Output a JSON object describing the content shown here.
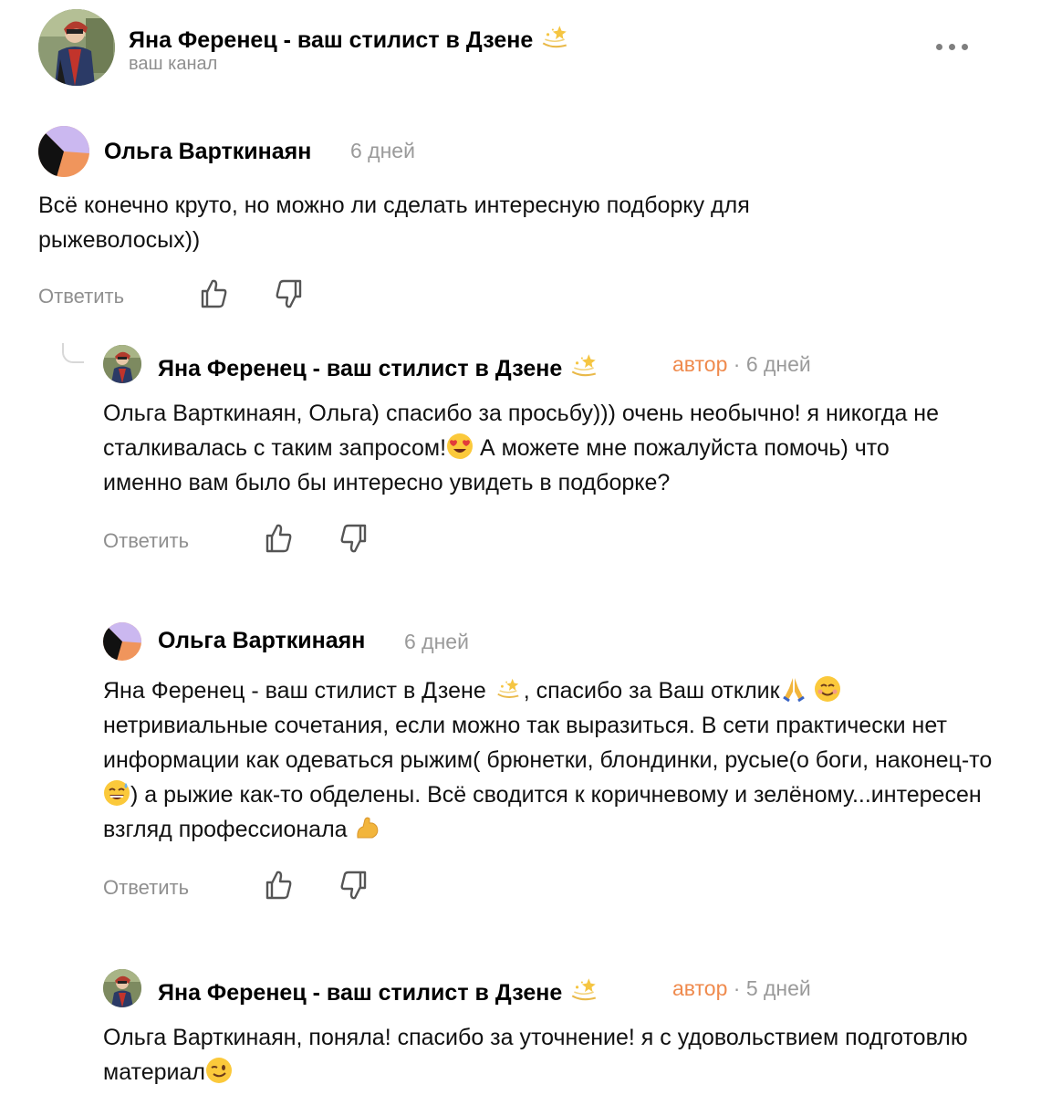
{
  "channel": {
    "title": "Яна Ференец - ваш стилист в Дзене",
    "subtitle": "ваш канал",
    "more_icon": "more-dots-icon"
  },
  "common": {
    "reply_label": "Ответить",
    "like_icon": "thumbs-up-icon",
    "dislike_icon": "thumbs-down-icon"
  },
  "comments": [
    {
      "author": "Ольга Варткинаян",
      "time": "6 дней",
      "text": "Всё конечно круто, но можно ли сделать интересную подборку для рыжеволосых))"
    },
    {
      "author": "Яна Ференец - ваш стилист в Дзене",
      "badge": "автор",
      "time": "6 дней",
      "text_parts": [
        "Ольга Варткинаян, Ольга) спасибо за просьбу))) очень необычно! я никогда не сталкивалась с таким запросом!",
        " А можете мне пожалуйста помочь) что именно вам было бы интересно увидеть в подборке?"
      ]
    },
    {
      "author": "Ольга Варткинаян",
      "time": "6 дней",
      "text_parts": [
        "Яна Ференец - ваш стилист в Дзене ",
        ", спасибо за Ваш отклик",
        " нетривиальные сочетания, если можно так выразиться. В сети практически нет информации как одеваться рыжим( брюнетки, блондинки, русые(о боги, наконец-то",
        ") а рыжие как-то обделены. Всё сводится к коричневому и зелёному...интересен взгляд профессионала"
      ]
    },
    {
      "author": "Яна Ференец - ваш стилист в Дзене",
      "badge": "автор",
      "time": "5 дней",
      "text_parts": [
        "Ольга Варткинаян, поняла! спасибо за уточнение! я с удовольствием подготовлю материал"
      ]
    }
  ],
  "colors": {
    "author_badge": "#ef8a4d",
    "meta_gray": "#9a9a9a",
    "avatar_purple": "#cbb8f0",
    "avatar_orange": "#f0955c"
  }
}
